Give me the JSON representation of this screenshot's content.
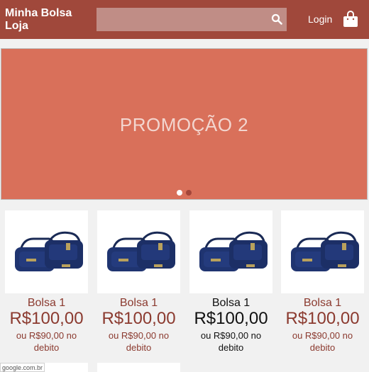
{
  "header": {
    "logo_line1": "Minha Bolsa",
    "logo_line2": "Loja",
    "search_placeholder": "",
    "login_label": "Login",
    "bg_color": "#a0483b"
  },
  "icons": {
    "search": "search-icon",
    "bag": "shopping-bag-icon"
  },
  "banner": {
    "text": "PROMOÇÃO 2",
    "bg_color": "#d9705a",
    "dots": [
      {
        "active": false
      },
      {
        "active": true
      }
    ]
  },
  "products": [
    {
      "name": "Bolsa 1",
      "price": "R$100,00",
      "debit_line1": "ou R$90,00 no",
      "debit_line2": "debito"
    },
    {
      "name": "Bolsa 1",
      "price": "R$100,00",
      "debit_line1": "ou R$90,00 no",
      "debit_line2": "debito"
    },
    {
      "name": "Bolsa 1",
      "price": "R$100,00",
      "debit_line1": "ou R$90,00 no",
      "debit_line2": "debito"
    },
    {
      "name": "Bolsa 1",
      "price": "R$100,00",
      "debit_line1": "ou R$90,00 no",
      "debit_line2": "debito"
    }
  ],
  "status_tooltip": "google.com.br"
}
